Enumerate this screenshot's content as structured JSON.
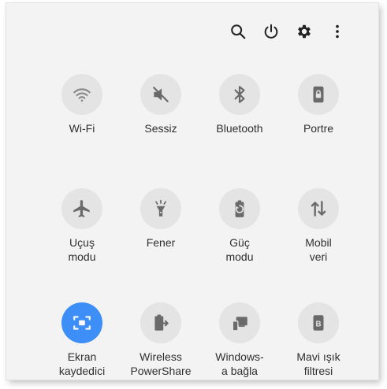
{
  "header_actions": [
    {
      "icon": "search-icon"
    },
    {
      "icon": "power-icon"
    },
    {
      "icon": "gear-icon"
    },
    {
      "icon": "more-vert-icon"
    }
  ],
  "tiles": [
    {
      "label": "Wi-Fi",
      "icon": "wifi-icon",
      "active": false
    },
    {
      "label": "Sessiz",
      "icon": "mute-icon",
      "active": false
    },
    {
      "label": "Bluetooth",
      "icon": "bluetooth-icon",
      "active": false
    },
    {
      "label": "Portre",
      "icon": "portrait-lock-icon",
      "active": false
    },
    {
      "label": "Uçuş\nmodu",
      "icon": "airplane-icon",
      "active": false
    },
    {
      "label": "Fener",
      "icon": "flashlight-icon",
      "active": false
    },
    {
      "label": "Güç\nmodu",
      "icon": "power-mode-icon",
      "active": false
    },
    {
      "label": "Mobil\nveri",
      "icon": "mobile-data-icon",
      "active": false
    },
    {
      "label": "Ekran\nkaydedici",
      "icon": "screen-recorder-icon",
      "active": true
    },
    {
      "label": "Wireless\nPowerShare",
      "icon": "wireless-powershare-icon",
      "active": false
    },
    {
      "label": "Windows-\na bağla",
      "icon": "link-to-windows-icon",
      "active": false
    },
    {
      "label": "Mavi ışık\nfiltresi",
      "icon": "blue-light-filter-icon",
      "active": false
    }
  ],
  "colors": {
    "accent": "#3d8ef6",
    "tile_bg": "#e4e4e4",
    "icon": "#6a6a6a",
    "panel_bg": "#f3f3f3"
  }
}
